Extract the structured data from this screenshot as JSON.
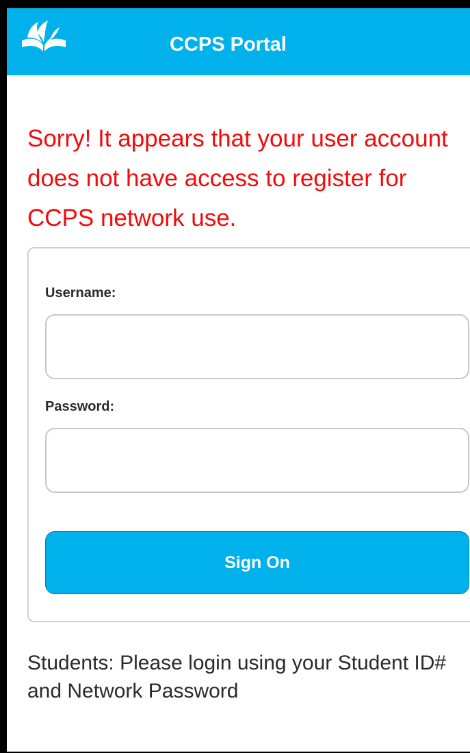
{
  "app": {
    "title": "CCPS Portal",
    "logo_icon": "open-book-icon",
    "brand_color": "#00b1ec"
  },
  "error": {
    "message": "Sorry! It appears that your user account does not have access to register for CCPS network use.",
    "color": "#f50a0a"
  },
  "form": {
    "username_label": "Username:",
    "username_value": "",
    "password_label": "Password:",
    "password_value": "",
    "submit_label": "Sign On"
  },
  "footer": {
    "note": "Students: Please login using your Student ID# and Network Password"
  }
}
